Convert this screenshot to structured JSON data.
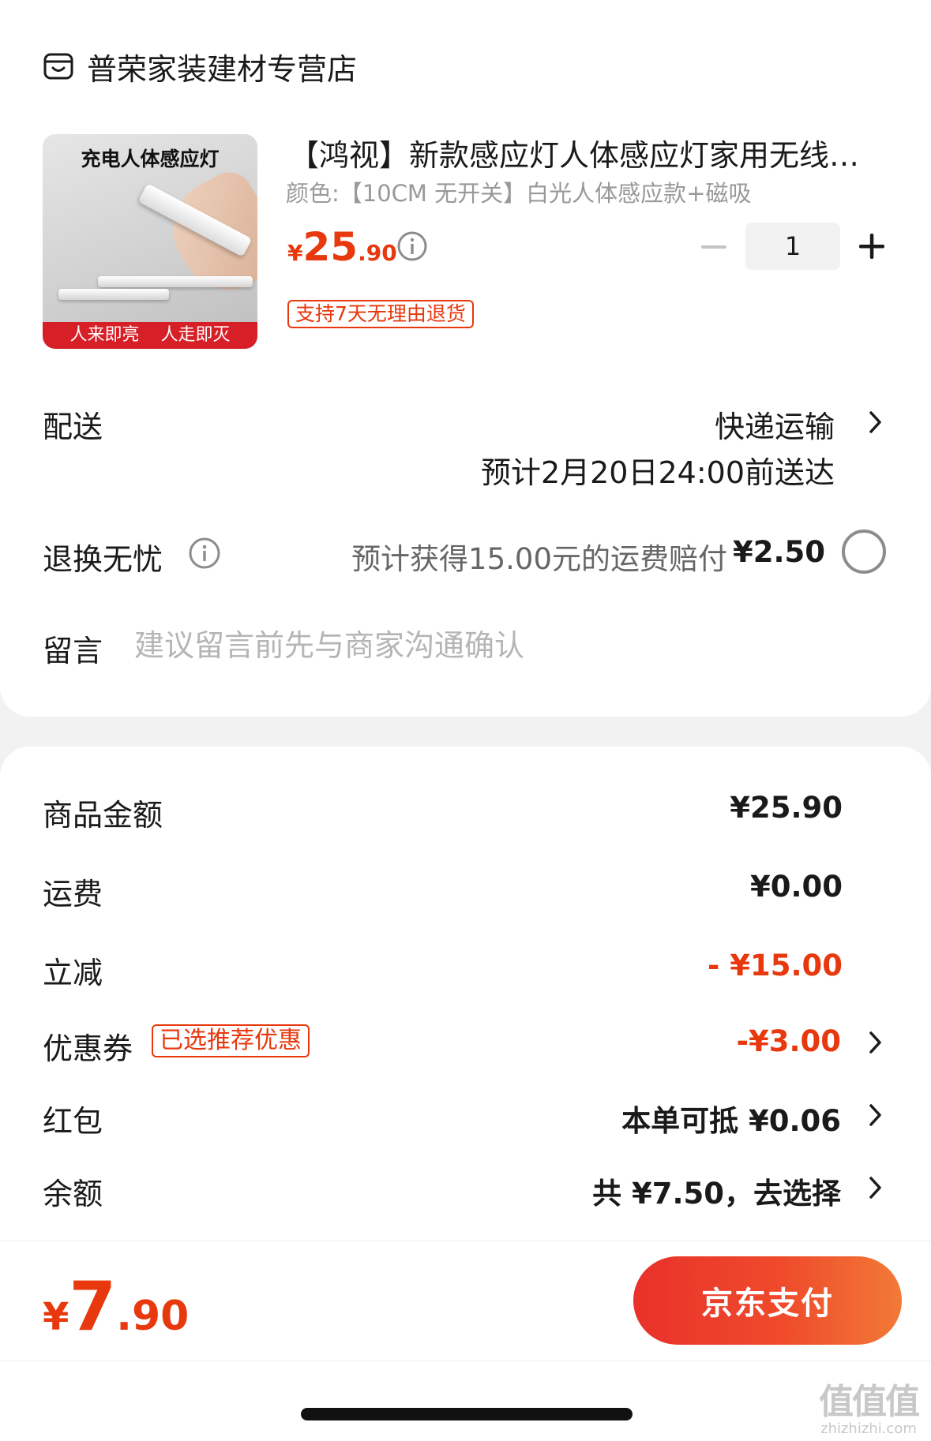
{
  "store": {
    "name": "普荣家装建材专营店",
    "icon": "store-icon"
  },
  "product": {
    "image_title": "充电人体感应灯",
    "image_banner": "人来即亮 人走即灭",
    "title": "【鸿视】新款感应灯人体感应灯家用无线…",
    "spec": "颜色:【10CM 无开关】白光人体感应款+磁吸",
    "price_currency": "¥",
    "price_int": "25",
    "price_dec": ".90",
    "quantity": "1",
    "return_tag": "支持7天无理由退货"
  },
  "delivery": {
    "label": "配送",
    "method": "快递运输",
    "eta": "预计2月20日24:00前送达"
  },
  "returns": {
    "label": "退换无忧",
    "desc": "预计获得15.00元的运费赔付",
    "price": "¥2.50",
    "selected": false
  },
  "message": {
    "label": "留言",
    "placeholder": "建议留言前先与商家沟通确认"
  },
  "summary": {
    "goods_label": "商品金额",
    "goods_value": "¥25.90",
    "shipping_label": "运费",
    "shipping_value": "¥0.00",
    "discount_label": "立减",
    "discount_value": "- ¥15.00",
    "coupon_label": "优惠券",
    "coupon_tag": "已选推荐优惠",
    "coupon_value": "-¥3.00",
    "redpacket_label": "红包",
    "redpacket_value": "本单可抵 ¥0.06",
    "balance_label": "余额",
    "balance_value": "共 ¥7.50，去选择"
  },
  "footer": {
    "total_currency": "¥",
    "total_int": "7",
    "total_dec": ".90",
    "pay_label": "京东支付"
  },
  "watermark": {
    "logo": "值值值",
    "url": "zhizhizhi.com"
  },
  "colors": {
    "accent": "#e8380d",
    "muted": "#999999",
    "background": "#f2f2f2"
  }
}
